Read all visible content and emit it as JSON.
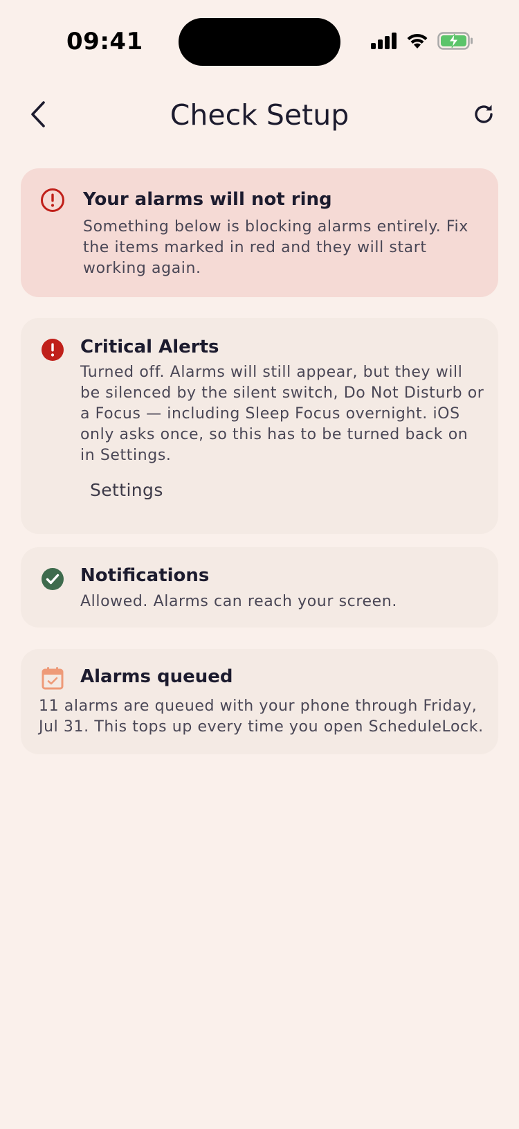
{
  "status_bar": {
    "time": "09:41",
    "signal_icon": "cellular-signal-icon",
    "wifi_icon": "wifi-icon",
    "battery_icon": "battery-charging-icon"
  },
  "nav": {
    "title": "Check Setup",
    "back_icon": "chevron-left-icon",
    "refresh_icon": "refresh-icon"
  },
  "banner": {
    "icon": "alert-circle-outline-icon",
    "title": "Your alarms will not ring",
    "body": "Something below is blocking alarms entirely. Fix the items marked in red and they will start working again."
  },
  "checks": [
    {
      "icon": "alert-circle-filled-icon",
      "status": "error",
      "title": "Critical Alerts",
      "body": "Turned off. Alarms will still appear, but they will be silenced by the silent switch, Do Not Disturb or a Focus — including Sleep Focus overnight. iOS only asks once, so this has to be turned back on in Settings.",
      "action_label": "Settings"
    },
    {
      "icon": "check-circle-icon",
      "status": "ok",
      "title": "Notifications",
      "body": "Allowed. Alarms can reach your screen."
    },
    {
      "icon": "calendar-check-icon",
      "status": "info",
      "title": "Alarms queued",
      "body": "11 alarms are queued with your phone through Friday, Jul 31. This tops up every time you open ScheduleLock."
    }
  ],
  "colors": {
    "background": "#FAF0EB",
    "banner_background": "#F5DAD5",
    "card_background": "#F4EAE4",
    "error_red": "#C0201A",
    "success_green": "#3E6B4D",
    "calendar_orange": "#EE9A78",
    "battery_green": "#5BC46A"
  }
}
